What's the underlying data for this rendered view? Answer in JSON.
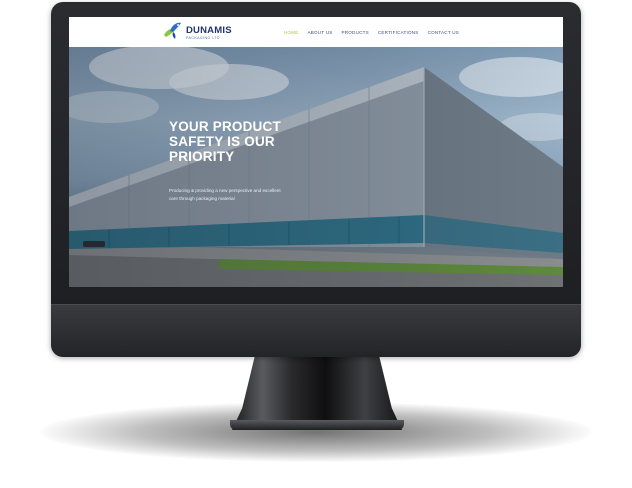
{
  "logo": {
    "name": "DUNAMIS",
    "tagline": "PACKAGING LTD"
  },
  "nav": {
    "items": [
      {
        "label": "HOME",
        "active": true
      },
      {
        "label": "ABOUT US",
        "active": false
      },
      {
        "label": "PRODUCTS",
        "active": false
      },
      {
        "label": "CERTIFICATIONS",
        "active": false
      },
      {
        "label": "CONTACT US",
        "active": false
      }
    ]
  },
  "hero": {
    "title": "YOUR PRODUCT\nSAFETY IS OUR\nPRIORITY",
    "subtitle": "Producing & providing a new perspective and excellent\ncare through packaging material"
  },
  "colors": {
    "brand_navy": "#21356b",
    "nav_link": "#3f4f90",
    "nav_active": "#b5c24f",
    "logo_bird_blue": "#2f6fc3",
    "logo_bird_green": "#8dc63f"
  },
  "icons": {
    "logo_mark": "bird-logo-icon"
  }
}
